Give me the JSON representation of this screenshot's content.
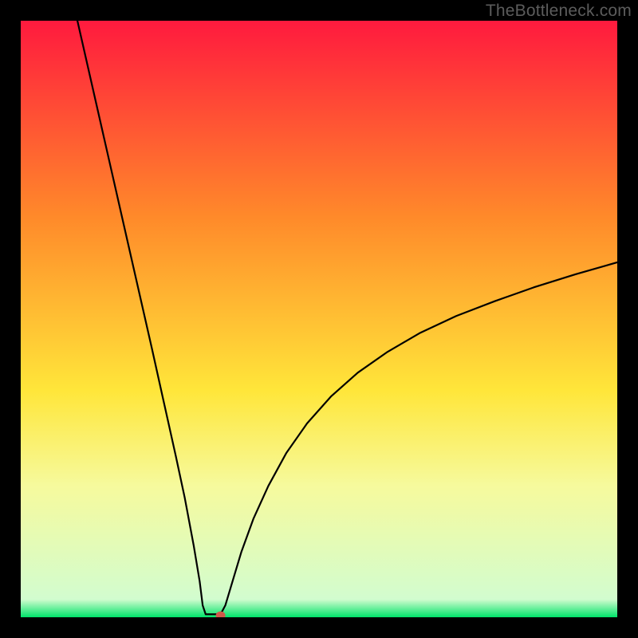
{
  "watermark": "TheBottleneck.com",
  "chart_data": {
    "type": "line",
    "title": "",
    "xlabel": "",
    "ylabel": "",
    "xlim": [
      0,
      100
    ],
    "ylim": [
      0,
      100
    ],
    "grid": false,
    "legend": false,
    "background_gradient": {
      "top_color": "#ff1a3e",
      "mid_color_1": "#ff8a2a",
      "mid_color_2": "#ffe63a",
      "mid_color_3": "#f6fa9d",
      "bottom_color": "#00e46a",
      "highlight_stop": 0.78
    },
    "curve": {
      "description": "V-shaped bottleneck curve with steep left descent, narrow minimum, and concave right ascent",
      "minimum_x": 32,
      "minimum_y": 0,
      "left_top_y": 100,
      "right_top_y": 60,
      "points": [
        {
          "x": 9.5,
          "y": 100.0
        },
        {
          "x": 12.0,
          "y": 89.0
        },
        {
          "x": 14.5,
          "y": 78.0
        },
        {
          "x": 17.0,
          "y": 67.0
        },
        {
          "x": 19.5,
          "y": 56.0
        },
        {
          "x": 22.0,
          "y": 45.0
        },
        {
          "x": 24.0,
          "y": 36.0
        },
        {
          "x": 26.0,
          "y": 27.0
        },
        {
          "x": 27.5,
          "y": 20.0
        },
        {
          "x": 29.0,
          "y": 12.0
        },
        {
          "x": 30.0,
          "y": 6.0
        },
        {
          "x": 30.5,
          "y": 2.0
        },
        {
          "x": 31.0,
          "y": 0.5
        },
        {
          "x": 33.5,
          "y": 0.5
        },
        {
          "x": 34.3,
          "y": 2.0
        },
        {
          "x": 35.5,
          "y": 6.0
        },
        {
          "x": 37.0,
          "y": 11.0
        },
        {
          "x": 39.0,
          "y": 16.5
        },
        {
          "x": 41.5,
          "y": 22.0
        },
        {
          "x": 44.5,
          "y": 27.5
        },
        {
          "x": 48.0,
          "y": 32.5
        },
        {
          "x": 52.0,
          "y": 37.0
        },
        {
          "x": 56.5,
          "y": 41.0
        },
        {
          "x": 61.5,
          "y": 44.5
        },
        {
          "x": 67.0,
          "y": 47.7
        },
        {
          "x": 73.0,
          "y": 50.5
        },
        {
          "x": 79.5,
          "y": 53.0
        },
        {
          "x": 86.0,
          "y": 55.3
        },
        {
          "x": 93.0,
          "y": 57.5
        },
        {
          "x": 100.0,
          "y": 59.5
        }
      ]
    },
    "marker": {
      "x": 33.5,
      "y": 0.3,
      "color": "#d05a4a",
      "radius_px": 6
    }
  }
}
